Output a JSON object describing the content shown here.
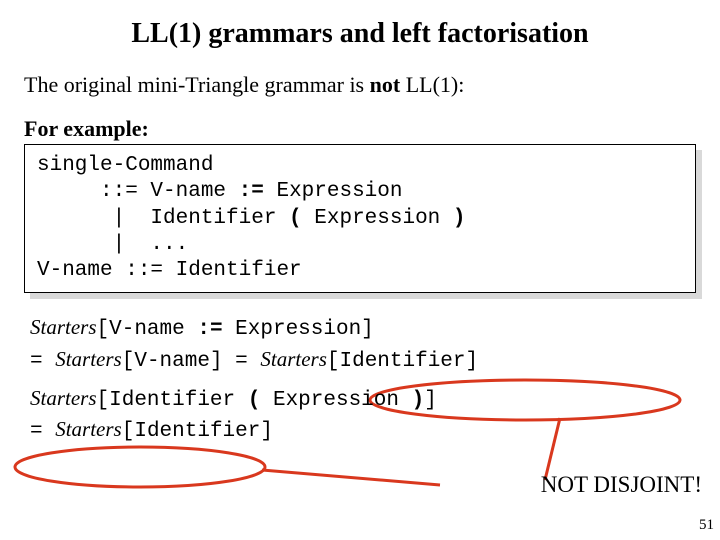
{
  "title": "LL(1) grammars and left factorisation",
  "intro_text": "The original mini-Triangle grammar is ",
  "intro_emph": "not",
  "intro_tail": " LL(1):",
  "for_example": "For example:",
  "grammar": {
    "l1": "single-Command",
    "l2_a": "     ::= V-name ",
    "l2_assign": ":=",
    "l2_b": " Expression",
    "l3_a": "      |  Identifier ",
    "l3_lp": "(",
    "l3_b": " Expression ",
    "l3_rp": ")",
    "l4": "      |  ...",
    "l5": "V-name ::= Identifier"
  },
  "starters": {
    "s1_a": "Starters",
    "s1_b": "[V-name ",
    "s1_assign": ":=",
    "s1_c": " Expression]",
    "s1_eq": "   = ",
    "s1_d": "Starters",
    "s1_e": "[V-name]",
    "s1_eq2": " = ",
    "s1_f": "Starters",
    "s1_g": "[Identifier]",
    "s2_a": "Starters",
    "s2_b": "[Identifier ",
    "s2_lp": "(",
    "s2_c": " Expression ",
    "s2_rp": ")",
    "s2_d": "]",
    "s2_eq": " = ",
    "s2_e": "Starters",
    "s2_f": "[Identifier]"
  },
  "not_disjoint": "NOT DISJOINT!",
  "page_num": "51",
  "colors": {
    "annotation": "#d9381e"
  }
}
